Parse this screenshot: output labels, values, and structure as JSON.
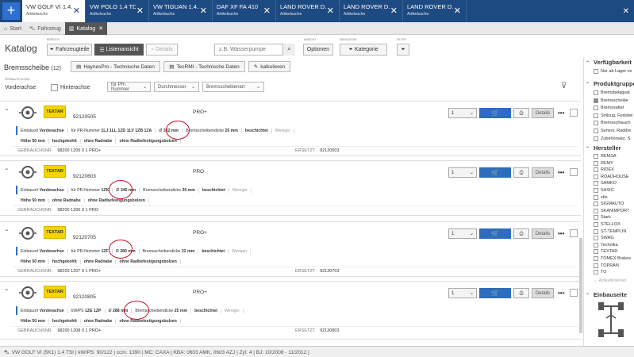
{
  "tabs": [
    {
      "title": "VW GOLF VI 1.4...",
      "sub": "Artikelsuche",
      "active": true
    },
    {
      "title": "VW POLO 1.4 TDI",
      "sub": "Artikelsuche",
      "active": false
    },
    {
      "title": "VW TIGUAN 1.4...",
      "sub": "Artikelsuche",
      "active": false
    },
    {
      "title": "DAF XF FA 410",
      "sub": "Artikelsuche",
      "active": false
    },
    {
      "title": "LAND ROVER D...",
      "sub": "Artikelsuche",
      "active": false
    },
    {
      "title": "LAND ROVER D...",
      "sub": "Artikelsuche",
      "active": false
    },
    {
      "title": "LAND ROVER D...",
      "sub": "Artikelsuche",
      "active": false
    }
  ],
  "subtabs": [
    {
      "label": "Start",
      "icon": "home-icon"
    },
    {
      "label": "Fahrzeug",
      "icon": "car-icon"
    },
    {
      "label": "Katalog",
      "icon": "book-icon",
      "active": true
    }
  ],
  "toolbar": {
    "title": "Katalog",
    "bereich_label": "BEREICH",
    "fahrzeugteile": "Fahrzeugteile",
    "listenansicht": "Listenansicht",
    "details": "Details",
    "search_placeholder": "z.B. Wasserpumpe",
    "ansicht_label": "ANSICHT",
    "optionen": "Optionen",
    "navigation_label": "NAVIGATION",
    "kategorie": "Kategorie",
    "filter_label": "FILTER"
  },
  "section": {
    "title": "Bremsscheibe",
    "count": "(12)",
    "btn1": "HaynesPro - Technische Daten",
    "btn2": "TecRMI - Technische Daten",
    "btn3": "kalkulieren"
  },
  "filters": {
    "einbau_label": "VERBAUTE ACHSE",
    "vorderachse": "Vorderachse",
    "hinterachse": "Hinterachse",
    "sel1": "für PR-Nummer",
    "sel2": "Durchmesser",
    "sel3": "Bremsscheibenart"
  },
  "articles": [
    {
      "brand": "TEXTAR",
      "nr": "92120505",
      "name": "PRO+",
      "qty": "1",
      "crit": [
        [
          "Einbauort",
          "Vorderachse"
        ],
        [
          "für PR-Nummer",
          "1LJ 1LL 1ZD 1LV 1ZB 1ZA"
        ],
        [
          "Ø",
          "312 mm"
        ],
        [
          "Bremsscheibendicke",
          "25 mm"
        ],
        [
          "",
          "beschichtet"
        ],
        [
          "",
          "Weniger"
        ]
      ],
      "crit2": [
        "Höhe 50 mm",
        "hochgekohlt",
        "ohne Radnabe",
        "ohne Radbefestigungsbolzen"
      ],
      "gebr_label": "GEBRAUCHSNR.",
      "gebr": "98200 1205 0 1 PRO+",
      "ersatz_label": "ERSETZT",
      "ersatz": "92120503"
    },
    {
      "brand": "TEXTAR",
      "nr": "92120603",
      "name": "PRO",
      "qty": "1",
      "crit": [
        [
          "Einbauort",
          "Vorderachse"
        ],
        [
          "für PR-Nummer",
          "1ZK"
        ],
        [
          "Ø",
          "345 mm"
        ],
        [
          "Bremsscheibendicke",
          "30 mm"
        ],
        [
          "",
          "beschichtet"
        ],
        [
          "",
          "Weniger"
        ]
      ],
      "crit2": [
        "Höhe 50 mm",
        "ohne Radnabe",
        "ohne Radbefestigungsbolzen"
      ],
      "gebr_label": "GEBRAUCHSNR.",
      "gebr": "98200 1206 0 1 PRO",
      "ersatz_label": "",
      "ersatz": ""
    },
    {
      "brand": "TEXTAR",
      "nr": "92120705",
      "name": "PRO+",
      "qty": "1",
      "crit": [
        [
          "Einbauort",
          "Vorderachse"
        ],
        [
          "für PR-Nummer",
          "1ZF"
        ],
        [
          "Ø",
          "280 mm"
        ],
        [
          "Bremsscheibendicke",
          "22 mm"
        ],
        [
          "",
          "beschichtet"
        ],
        [
          "",
          "Weniger"
        ]
      ],
      "crit2": [
        "Höhe 50 mm",
        "hochgekohlt",
        "ohne Radnabe",
        "ohne Radbefestigungsbolzen"
      ],
      "gebr_label": "GEBRAUCHSNR.",
      "gebr": "98200 1207 0 1 PRO+",
      "ersatz_label": "ERSETZT",
      "ersatz": "92120703"
    },
    {
      "brand": "TEXTAR",
      "nr": "92120805",
      "name": "PRO+",
      "qty": "1",
      "crit": [
        [
          "Einbauort",
          "Vorderachse"
        ],
        [
          "kW/PS",
          "1ZE 1ZP"
        ],
        [
          "Ø",
          "288 mm"
        ],
        [
          "Bremsscheibendicke",
          "25 mm"
        ],
        [
          "",
          "beschichtet"
        ],
        [
          "",
          "Weniger"
        ]
      ],
      "crit2": [
        "Höhe 50 mm",
        "hochgekohlt",
        "ohne Radnabe",
        "ohne Radbefestigungsbolzen"
      ],
      "gebr_label": "GEBRAUCHSNR.",
      "gebr": "98200 1208 0 1 PRO+",
      "ersatz_label": "ERSETZT",
      "ersatz": "92120803"
    }
  ],
  "article_buttons": {
    "details": "Details",
    "more": "•••"
  },
  "right": {
    "verf_title": "Verfügbarkeit",
    "verf_item": "Nur ab Lager ve",
    "pg_title": "Produktgruppe",
    "pg_items": [
      [
        "Bremsbelagsat",
        false
      ],
      [
        "Bremsscheibe",
        true
      ],
      [
        "Bremssattel",
        false
      ],
      [
        "Seilzug, Feststel",
        false
      ],
      [
        "Bremsschlauch",
        false
      ],
      [
        "Sensor, Raddre",
        false
      ],
      [
        "Zubehörsatz, S",
        false
      ]
    ],
    "h_title": "Hersteller",
    "h_items": [
      "REMSA",
      "REMY",
      "RIDEX",
      "ROADHOUSE",
      "SAMKO",
      "SASIC",
      "sbs",
      "SIGMAUTO",
      "SKANIMPORT",
      "Stark",
      "STELLOX",
      "ST-TEMPLIN",
      "SWAG",
      "Technika",
      "TEXTAR",
      "TOMEX Brakes",
      "TOPRAN",
      "TO"
    ],
    "ak": "Artikelkriterien",
    "eb_title": "Einbauseite"
  },
  "status": "VW GOLF VI (5K1) 1.4 TSI  |  kW/PS: 90/122  |  ccm: 1390  |  MC: CAXA  |  KBA: 0603 AMK, 0603 AZJ  |  Zyl: 4  |  BJ: 10/2008 - 11/2012  |"
}
